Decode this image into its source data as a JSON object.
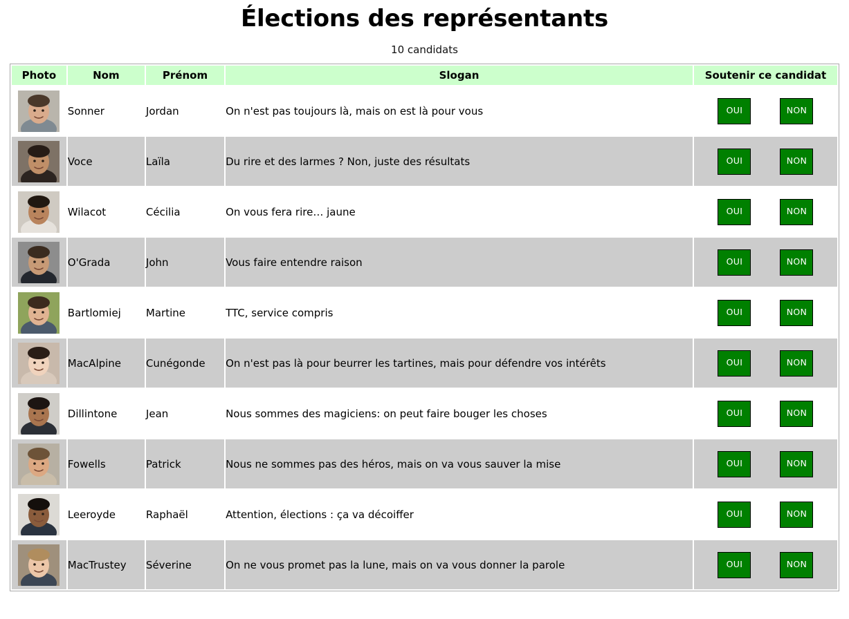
{
  "page": {
    "title": "Élections des représentants",
    "subtitle": "10 candidats"
  },
  "table": {
    "columns": {
      "photo": "Photo",
      "nom": "Nom",
      "prenom": "Prénom",
      "slogan": "Slogan",
      "support": "Soutenir ce candidat"
    },
    "vote": {
      "yes_label": "OUI",
      "no_label": "NON"
    },
    "colors": {
      "header_background": "#ccffcc",
      "row_alt_background": "#cccccc",
      "row_background": "#ffffff",
      "button_background": "#008000",
      "button_text": "#ffffff",
      "button_border": "#000000",
      "table_border": "#a9a9a9"
    },
    "rows": [
      {
        "nom": "Sonner",
        "prenom": "Jordan",
        "slogan": "On n'est pas toujours là, mais on est là pour vous",
        "photo": "portrait-bearded-man-glasses",
        "photo_colors": {
          "bg": "#b9b5ac",
          "skin": "#d9ab8c",
          "hair": "#4a382a",
          "shirt": "#7f8a92"
        }
      },
      {
        "nom": "Voce",
        "prenom": "Laïla",
        "slogan": "Du rire et des larmes ? Non, juste des résultats",
        "photo": "portrait-smiling-woman-dark-hair",
        "photo_colors": {
          "bg": "#7e7266",
          "skin": "#c08f68",
          "hair": "#271c16",
          "shirt": "#2c2420"
        }
      },
      {
        "nom": "Wilacot",
        "prenom": "Cécilia",
        "slogan": "On vous fera rire… jaune",
        "photo": "portrait-curly-hair-woman",
        "photo_colors": {
          "bg": "#cfcac2",
          "skin": "#b9845d",
          "hair": "#211811",
          "shirt": "#e6e2dc"
        }
      },
      {
        "nom": "O'Grada",
        "prenom": "John",
        "slogan": "Vous faire entendre raison",
        "photo": "portrait-man-suit-tie",
        "photo_colors": {
          "bg": "#8d8d8d",
          "skin": "#c79a76",
          "hair": "#3a2b1f",
          "shirt": "#23272e"
        }
      },
      {
        "nom": "Bartlomiej",
        "prenom": "Martine",
        "slogan": "TTC, service compris",
        "photo": "portrait-woman-short-hair-outdoors",
        "photo_colors": {
          "bg": "#8fa45c",
          "skin": "#e0b392",
          "hair": "#3b2a1e",
          "shirt": "#4b5a6b"
        }
      },
      {
        "nom": "MacAlpine",
        "prenom": "Cunégonde",
        "slogan": "On n'est pas là pour beurrer les tartines, mais pour défendre vos intérêts",
        "photo": "portrait-woman-long-dark-hair-smiling",
        "photo_colors": {
          "bg": "#c8b9ab",
          "skin": "#f0d3bd",
          "hair": "#2a1d16",
          "shirt": "#d8c9bb"
        }
      },
      {
        "nom": "Dillintone",
        "prenom": "Jean",
        "slogan": "Nous sommes des magiciens: on peut faire bouger les choses",
        "photo": "portrait-man-glasses-mustache",
        "photo_colors": {
          "bg": "#cfcdc8",
          "skin": "#a9754f",
          "hair": "#1c1512",
          "shirt": "#2b2f36"
        }
      },
      {
        "nom": "Fowells",
        "prenom": "Patrick",
        "slogan": "Nous ne sommes pas des héros, mais on va vous sauver la mise",
        "photo": "portrait-man-light-beard",
        "photo_colors": {
          "bg": "#b7b0a3",
          "skin": "#dca882",
          "hair": "#6d5338",
          "shirt": "#c9bda9"
        }
      },
      {
        "nom": "Leeroyde",
        "prenom": "Raphaël",
        "slogan": "Attention, élections : ça va décoiffer",
        "photo": "portrait-man-dark-skin-short-hair",
        "photo_colors": {
          "bg": "#dcdad5",
          "skin": "#8a5c3c",
          "hair": "#140f0c",
          "shirt": "#2a3340"
        }
      },
      {
        "nom": "MacTrustey",
        "prenom": "Séverine",
        "slogan": "On ne vous promet pas la lune, mais on va vous donner la parole",
        "photo": "portrait-blonde-woman",
        "photo_colors": {
          "bg": "#9f907c",
          "skin": "#ecc6a8",
          "hair": "#b08d5e",
          "shirt": "#3c4654"
        }
      }
    ]
  }
}
